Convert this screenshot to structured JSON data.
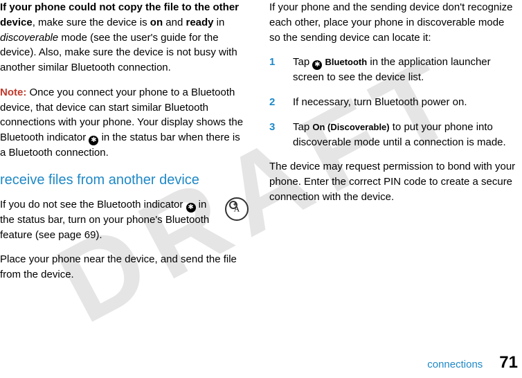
{
  "watermark": "DRAFT",
  "left": {
    "p1_a": "If your phone could not copy the file to the other device",
    "p1_b": ", make sure the device is ",
    "p1_on": "on",
    "p1_c": " and ",
    "p1_ready": "ready",
    "p1_d": " in ",
    "p1_disc": "discoverable",
    "p1_e": " mode (see the user's guide for the device). Also, make sure the device is not busy with another similar Bluetooth connection.",
    "note_label": "Note:",
    "note_body": " Once you connect your phone to a Bluetooth device, that device can start similar Bluetooth connections with your phone. Your display shows the Bluetooth indicator ",
    "note_body2": " in the status bar when there is a Bluetooth connection.",
    "h2": "receive files from another device",
    "p2_a": "If you do not see the Bluetooth indicator ",
    "p2_b": " in the status bar, turn on your phone's Bluetooth feature (see page 69).",
    "p3": "Place your phone near the device, and send the file from the device."
  },
  "right": {
    "p1": "If your phone and the sending device don't recognize each other, place your phone in discoverable mode so the sending device can locate it:",
    "steps": [
      {
        "num": "1",
        "pre": "Tap ",
        "ui": "Bluetooth",
        "post": " in the application launcher screen to see the device list.",
        "icon": true
      },
      {
        "num": "2",
        "pre": "If necessary, turn Bluetooth power on.",
        "ui": "",
        "post": "",
        "icon": false
      },
      {
        "num": "3",
        "pre": "Tap ",
        "ui": "On (Discoverable)",
        "post": " to put your phone into discoverable mode until a connection is made.",
        "icon": false
      }
    ],
    "p2": "The device may request permission to bond with your phone. Enter the correct PIN code to create a secure connection with the device."
  },
  "footer": {
    "section": "connections",
    "page": "71"
  }
}
